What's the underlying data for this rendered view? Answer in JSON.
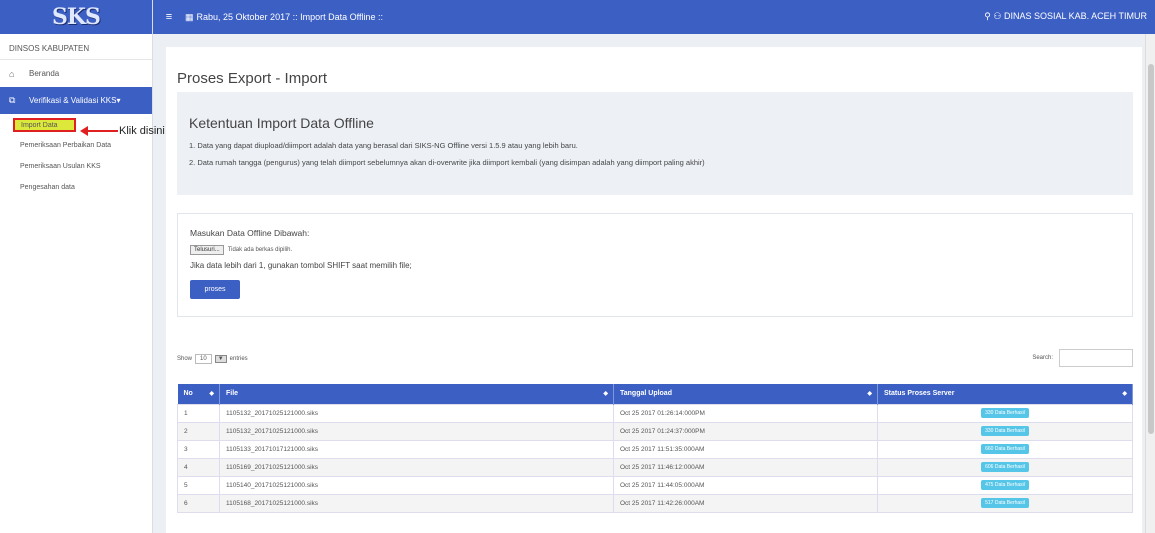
{
  "logo": "SKS",
  "topbar": {
    "date": "Rabu, 25 Oktober 2017 :: Import Data Offline ::",
    "user": "DINAS SOSIAL KAB. ACEH TIMUR",
    "hamburger": "≡",
    "calendar": "▦",
    "search": "⚲",
    "user_icon": "⚇"
  },
  "sidebar": {
    "header": "DINSOS KABUPATEN",
    "beranda": "Beranda",
    "verifikasi": "Verifikasi & Validasi KKS ",
    "home_icon": "⌂",
    "verif_icon": "⧉",
    "submenu": {
      "import": "Import Data",
      "item2": "Pemeriksaan Perbaikan Data",
      "item3": "Pemeriksaan Usulan KKS",
      "item4": "Pengesahan data"
    }
  },
  "annotation": "Klik disini",
  "main": {
    "title": "Proses Export - Import",
    "info_title": "Ketentuan Import Data Offline",
    "info_line1": "1. Data yang dapat diupload/diimport adalah data yang berasal dari SIKS-NG Offline versi 1.5.9 atau yang lebih baru.",
    "info_line2": "2. Data rumah tangga (pengurus) yang telah diimport sebelumnya akan di-overwrite jika diimport kembali (yang disimpan adalah yang diimport paling akhir)",
    "upload_label": "Masukan Data Offline Dibawah:",
    "file_button": "Telusuri...",
    "file_none": "Tidak ada berkas dipilih.",
    "hint": "Jika data lebih dari 1, gunakan tombol SHIFT saat memilih file;",
    "proses": "proses",
    "show_label": "Show",
    "show_value": "10",
    "entries_label": "entries",
    "search_label": "Search:"
  },
  "table": {
    "headers": {
      "no": "No",
      "file": "File",
      "tanggal": "Tanggal Upload",
      "status": "Status Proses Server"
    },
    "rows": [
      {
        "no": "1",
        "file": "1105132_20171025121000.siks",
        "tanggal": "Oct 25 2017 01:26:14:000PM",
        "status": "330 Data Berhasil"
      },
      {
        "no": "2",
        "file": "1105132_20171025121000.siks",
        "tanggal": "Oct 25 2017 01:24:37:000PM",
        "status": "330 Data Berhasil"
      },
      {
        "no": "3",
        "file": "1105133_20171017121000.siks",
        "tanggal": "Oct 25 2017 11:51:35:000AM",
        "status": "660 Data Berhasil"
      },
      {
        "no": "4",
        "file": "1105169_20171025121000.siks",
        "tanggal": "Oct 25 2017 11:46:12:000AM",
        "status": "606 Data Berhasil"
      },
      {
        "no": "5",
        "file": "1105140_20171025121000.siks",
        "tanggal": "Oct 25 2017 11:44:05:000AM",
        "status": "475 Data Berhasil"
      },
      {
        "no": "6",
        "file": "1105168_20171025121000.siks",
        "tanggal": "Oct 25 2017 11:42:26:000AM",
        "status": "517 Data Berhasil"
      }
    ]
  },
  "colors": {
    "primary": "#3c5fc4",
    "badge": "#55c6e8",
    "highlight": "#dde93a",
    "annot": "#e02020"
  }
}
